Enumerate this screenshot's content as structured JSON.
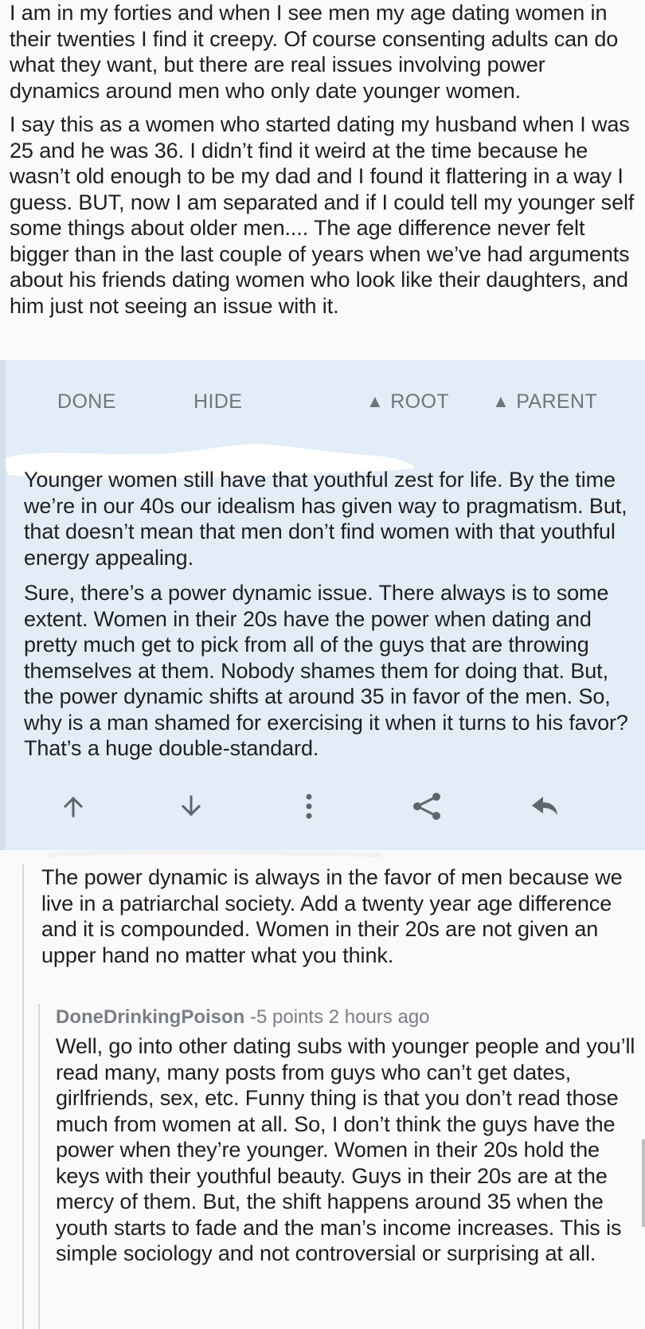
{
  "parent_comment": {
    "paragraphs": [
      "I am in my forties and when I see men my age dating women in their twenties I find it creepy. Of course consenting adults can do what they want, but there are real issues involving power dynamics around men who only date younger women.",
      "I say this as a women who started dating my husband when I was 25 and he was 36. I didn’t find it weird at the time because he wasn’t old enough to be my dad and I found it flattering in a way I guess. BUT, now I am separated and if I could tell my younger self some things about older men.... The age difference never felt bigger than in the last couple of years when we’ve had arguments about his friends dating women who look like their daughters, and him just not seeing an issue with it."
    ]
  },
  "selected_comment": {
    "actions": {
      "done": "DONE",
      "hide": "HIDE",
      "root": "ROOT",
      "parent": "PARENT"
    },
    "paragraphs": [
      "Younger women still have that youthful zest for life. By the time we’re in our 40s our idealism has given way to pragmatism. But, that doesn’t mean that men don’t find women with that youthful energy appealing.",
      "Sure, there’s a power dynamic issue. There always is to some extent. Women in their 20s have the power when dating and pretty much get to pick from all of the guys that are throwing themselves at them. Nobody shames them for doing that. But, the power dynamic shifts at around 35 in favor of the men. So, why is a man shamed for exercising it when it turns to his favor? That’s a huge double-standard."
    ],
    "toolbar_icons": [
      "upvote-arrow-icon",
      "downvote-arrow-icon",
      "more-vertical-icon",
      "share-icon",
      "reply-icon"
    ]
  },
  "reply_1": {
    "text": "The power dynamic is always in the favor of men because we live in a patriarchal society. Add a twenty year age difference and it is compounded. Women in their 20s are not given an upper hand no matter what you think."
  },
  "reply_2": {
    "author": "DoneDrinkingPoison",
    "points": "-5 points",
    "time": "2 hours ago",
    "text": "Well, go into other dating subs with younger people and you’ll read many, many posts from guys who can’t get dates, girlfriends, sex, etc. Funny thing is that you don’t read those much from women at all. So, I don’t think the guys have the power when they’re younger. Women in their 20s hold the keys with their youthful beauty. Guys in their 20s are at the mercy of them. But, the shift happens around 35 when the youth starts to fade and the man’s income increases. This is simple sociology and not controversial or surprising at all."
  },
  "colors": {
    "selected_bg": "#e3edf7",
    "action_text": "#6f757b",
    "body_text": "#1f1f1f",
    "meta_text": "#7a7f85"
  }
}
